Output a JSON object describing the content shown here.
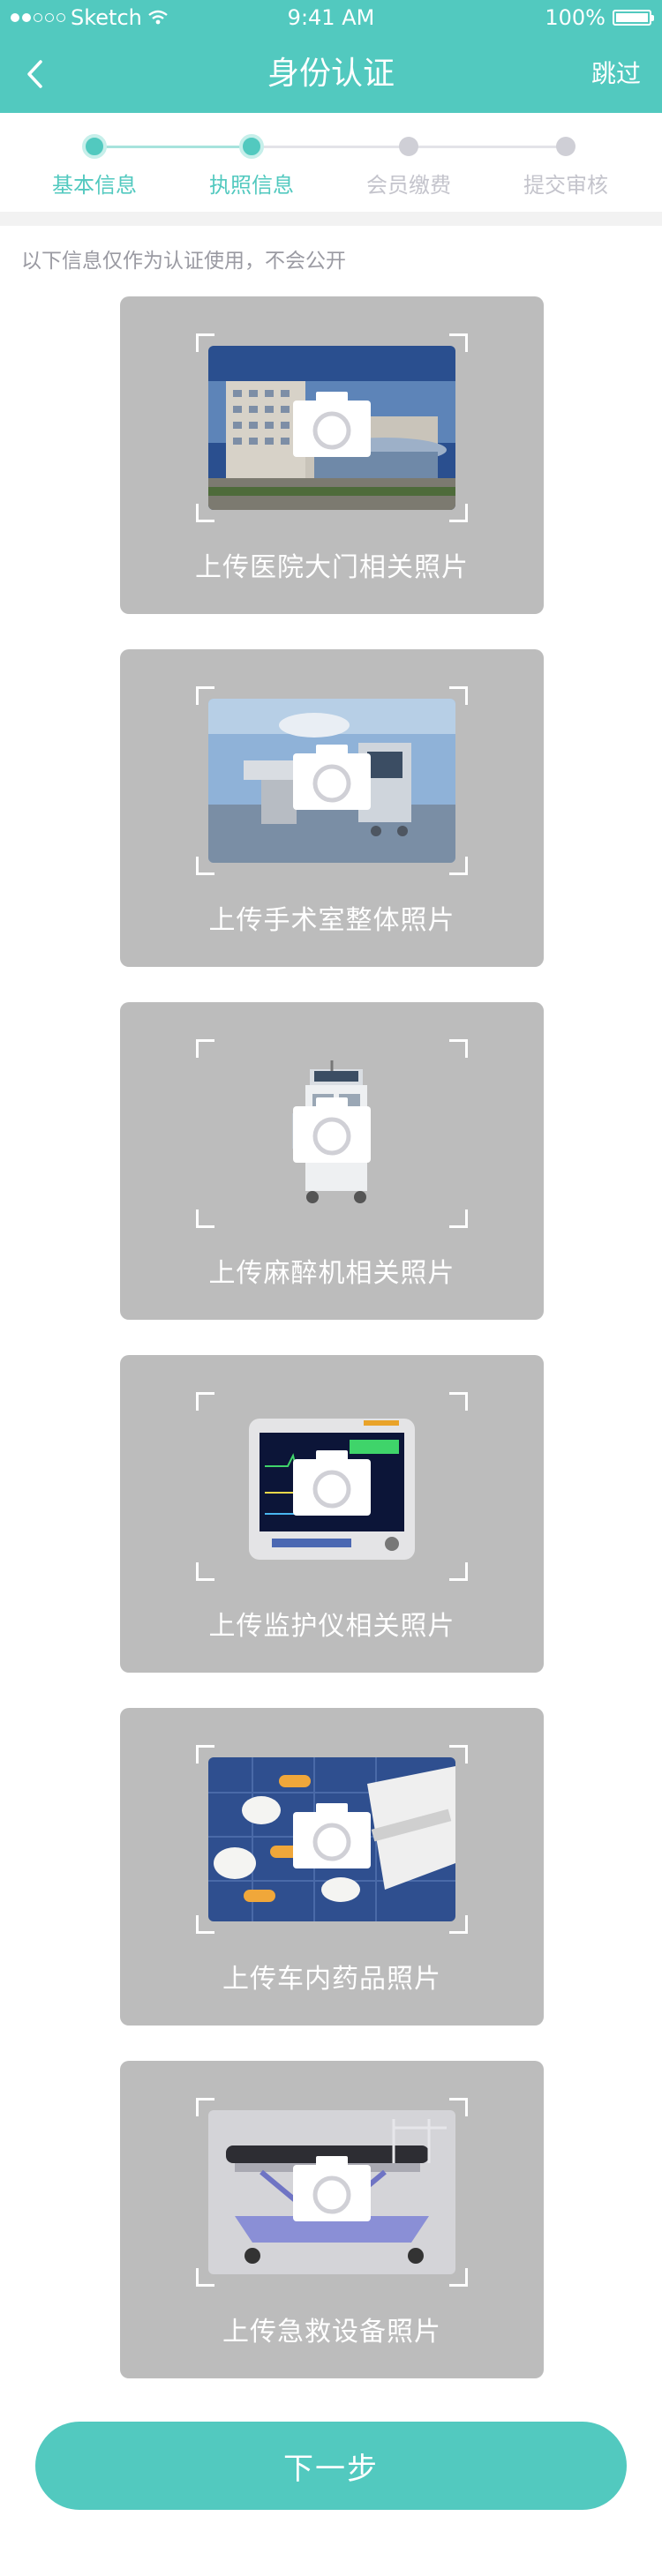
{
  "status_bar": {
    "carrier": "Sketch",
    "time": "9:41 AM",
    "battery": "100%"
  },
  "nav": {
    "title": "身份认证",
    "skip_label": "跳过"
  },
  "steps": [
    {
      "label": "基本信息",
      "state": "active"
    },
    {
      "label": "执照信息",
      "state": "active"
    },
    {
      "label": "会员缴费",
      "state": "inactive"
    },
    {
      "label": "提交审核",
      "state": "inactive"
    }
  ],
  "hint": "以下信息仅作为认证使用，不会公开",
  "uploads": [
    {
      "label": "上传医院大门相关照片",
      "image": "hospital-building"
    },
    {
      "label": "上传手术室整体照片",
      "image": "operating-room"
    },
    {
      "label": "上传麻醉机相关照片",
      "image": "anesthesia-machine"
    },
    {
      "label": "上传监护仪相关照片",
      "image": "patient-monitor"
    },
    {
      "label": "上传车内药品照片",
      "image": "medicine-pills"
    },
    {
      "label": "上传急救设备照片",
      "image": "emergency-stretcher"
    }
  ],
  "next_button": "下一步",
  "colors": {
    "accent": "#52c9bf",
    "card": "#bcbcbc",
    "muted": "#9a9aa2"
  }
}
